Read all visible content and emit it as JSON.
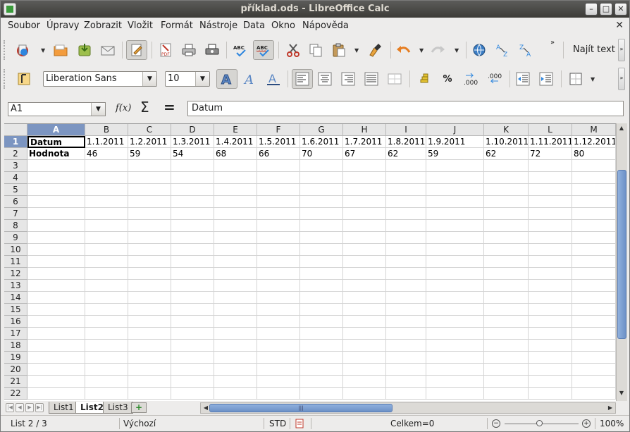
{
  "window": {
    "title": "příklad.ods - LibreOffice Calc",
    "minimize": "–",
    "maximize": "□",
    "close": "✕"
  },
  "menu": {
    "items": [
      "Soubor",
      "Úpravy",
      "Zobrazit",
      "Vložit",
      "Formát",
      "Nástroje",
      "Data",
      "Okno",
      "Nápověda"
    ],
    "close": "✕"
  },
  "toolbar": {
    "find_text": "Najít text",
    "more": "»"
  },
  "format_toolbar": {
    "font_name": "Liberation Sans",
    "font_size": "10",
    "percent": "%",
    "decimal_add": ".000",
    "decimal_remove": ".000"
  },
  "formula_bar": {
    "name_box": "A1",
    "fx": "f(x)",
    "sum": "Σ",
    "equals": "=",
    "content": "Datum"
  },
  "grid": {
    "columns": [
      "A",
      "B",
      "C",
      "D",
      "E",
      "F",
      "G",
      "H",
      "I",
      "J",
      "K",
      "L",
      "M"
    ],
    "rows": [
      "1",
      "2",
      "3",
      "4",
      "5",
      "6",
      "7",
      "8",
      "9",
      "10",
      "11",
      "12",
      "13",
      "14",
      "15",
      "16",
      "17",
      "18",
      "19",
      "20",
      "21",
      "22"
    ],
    "data": {
      "row1": [
        "Datum",
        "1.1.2011",
        "1.2.2011",
        "1.3.2011",
        "1.4.2011",
        "1.5.2011",
        "1.6.2011",
        "1.7.2011",
        "1.8.2011",
        "1.9.2011",
        "1.10.2011",
        "1.11.2011",
        "1.12.2011"
      ],
      "row2": [
        "Hodnota",
        "46",
        "59",
        "54",
        "68",
        "66",
        "70",
        "67",
        "62",
        "59",
        "62",
        "72",
        "80"
      ]
    },
    "active_cell": "A1"
  },
  "sheets": {
    "tabs": [
      "List1",
      "List2",
      "List3"
    ],
    "active": "List2",
    "add": "+"
  },
  "statusbar": {
    "sheet": "List 2 / 3",
    "style": "Výchozí",
    "mode": "STD",
    "sum": "Celkem=0",
    "zoom": "100%"
  }
}
